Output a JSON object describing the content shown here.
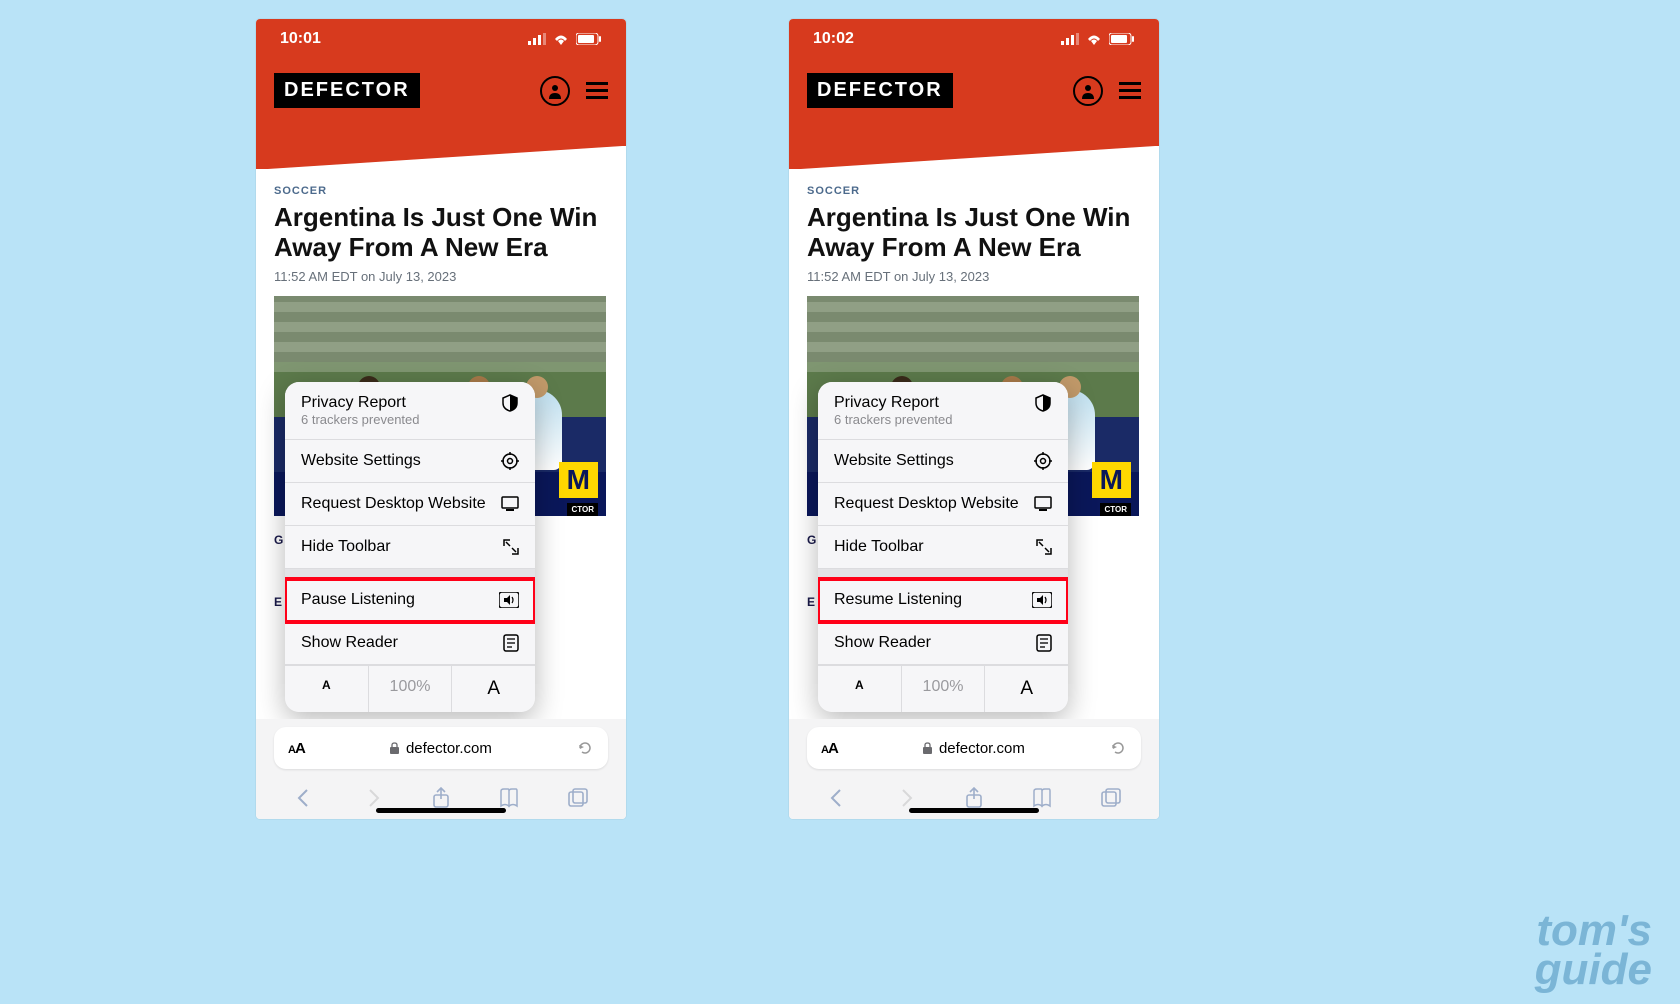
{
  "watermark": "tom's\nguide",
  "screens": [
    {
      "time": "10:01",
      "listen_label": "Pause Listening"
    },
    {
      "time": "10:02",
      "listen_label": "Resume Listening"
    }
  ],
  "site": {
    "logo": "DEFECTOR",
    "category": "SOCCER",
    "headline": "Argentina Is Just One Win Away From A New Era",
    "datetime": "11:52 AM EDT on July 13, 2023"
  },
  "menu": {
    "privacy_title": "Privacy Report",
    "privacy_subtitle": "6 trackers prevented",
    "website_settings": "Website Settings",
    "request_desktop": "Request Desktop Website",
    "hide_toolbar": "Hide Toolbar",
    "show_reader": "Show Reader",
    "zoom": "100%"
  },
  "address": {
    "domain": "defector.com"
  },
  "side_letters": {
    "g": "G",
    "e": "E"
  }
}
